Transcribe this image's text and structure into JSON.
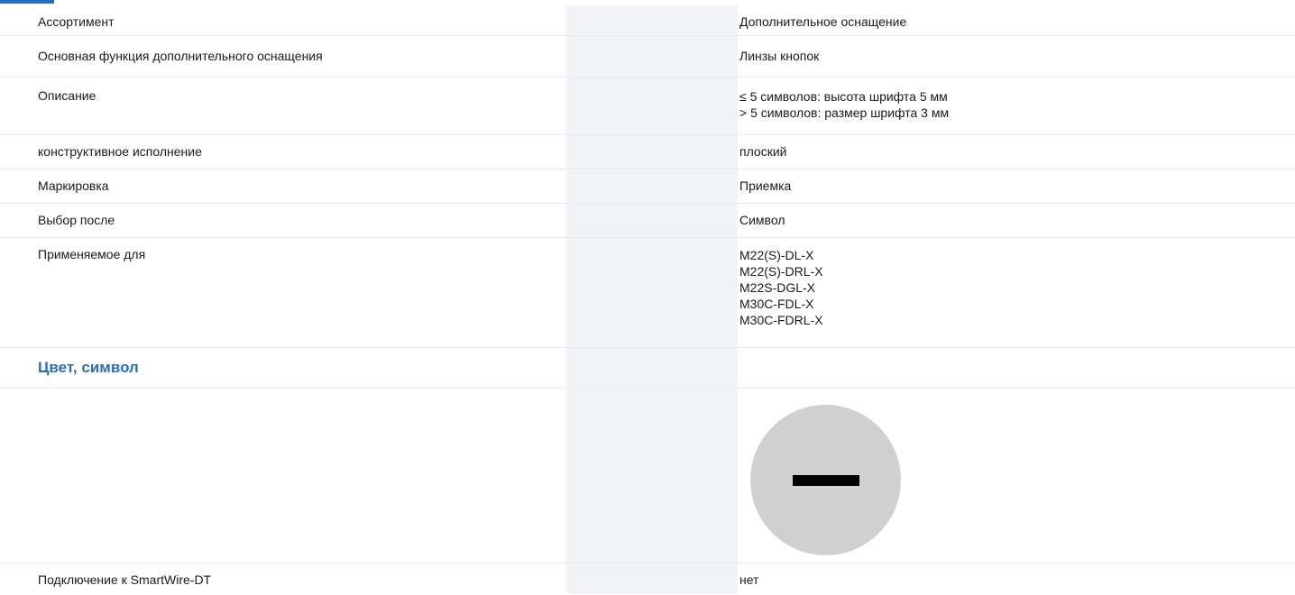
{
  "spec": {
    "rows": [
      {
        "label": "Ассортимент",
        "value": "Дополнительное оснащение"
      },
      {
        "label": "Основная функция дополнительного оснащения",
        "value": "Линзы кнопок"
      },
      {
        "label": "Описание",
        "value_lines": [
          "≤ 5 символов: высота шрифта 5 мм",
          "> 5 символов: размер шрифта 3 мм"
        ]
      },
      {
        "label": "конструктивное исполнение",
        "value": "плоский"
      },
      {
        "label": "Маркировка",
        "value": "Приемка"
      },
      {
        "label": "Выбор после",
        "value": "Символ"
      },
      {
        "label": "Применяемое для",
        "value_lines": [
          "M22(S)-DL-X",
          "M22(S)-DRL-X",
          "M22S-DGL-X",
          "M30C-FDL-X",
          "M30C-FDRL-X"
        ]
      }
    ],
    "section_title": "Цвет, символ",
    "symbol_icon": "minus-symbol-lens-icon",
    "symbol_color": "#d0d0d0",
    "last_row": {
      "label": "Подключение к SmartWire-DT",
      "value": "нет"
    }
  },
  "colors": {
    "accent": "#2a6ebb",
    "mid_column": "#f1f3f6",
    "divider": "#e9e9e9"
  }
}
